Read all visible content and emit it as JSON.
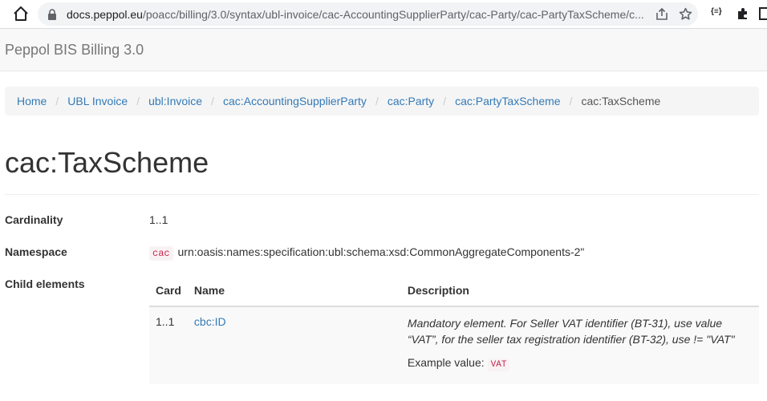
{
  "browser": {
    "url_host": "docs.peppol.eu",
    "url_path": "/poacc/billing/3.0/syntax/ubl-invoice/cac-AccountingSupplierParty/cac-Party/cac-PartyTaxScheme/c...",
    "extension_label": "{≡}",
    "icons": [
      "home-icon",
      "lock-icon",
      "share-icon",
      "star-icon",
      "extension-icon",
      "puzzle-icon",
      "side-panel-icon"
    ]
  },
  "navbar": {
    "brand": "Peppol BIS Billing 3.0"
  },
  "breadcrumb": {
    "items": [
      {
        "label": "Home"
      },
      {
        "label": "UBL Invoice"
      },
      {
        "label": "ubl:Invoice"
      },
      {
        "label": "cac:AccountingSupplierParty"
      },
      {
        "label": "cac:Party"
      },
      {
        "label": "cac:PartyTaxScheme"
      },
      {
        "label": "cac:TaxScheme"
      }
    ],
    "separator": "/"
  },
  "page": {
    "title": "cac:TaxScheme",
    "cardinality_label": "Cardinality",
    "cardinality_value": "1..1",
    "namespace_label": "Namespace",
    "namespace_prefix": "cac",
    "namespace_value": "urn:oasis:names:specification:ubl:schema:xsd:CommonAggregateComponents-2\"",
    "child_elements_label": "Child elements"
  },
  "child_table": {
    "headers": {
      "card": "Card",
      "name": "Name",
      "description": "Description"
    },
    "rows": [
      {
        "card": "1..1",
        "name": "cbc:ID",
        "description": "Mandatory element. For Seller VAT identifier (BT-31), use value “VAT”, for the seller tax registration identifier (BT-32), use != \"VAT\"",
        "example_label": "Example value:",
        "example_value": "VAT"
      }
    ]
  },
  "colors": {
    "link": "#337ab7",
    "code": "#c7254e",
    "code_bg": "#f9f2f4"
  }
}
